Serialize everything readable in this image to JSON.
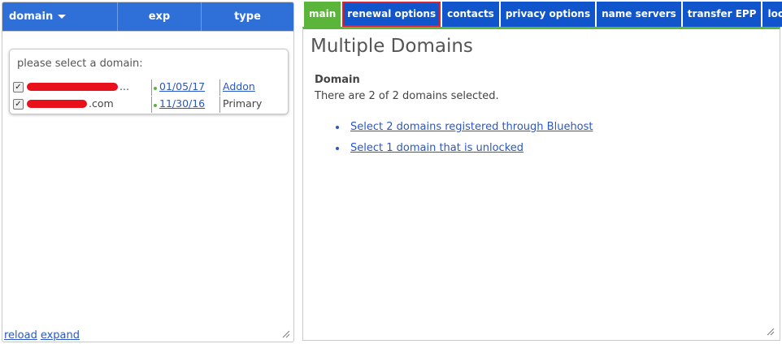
{
  "left_panel": {
    "columns": {
      "domain": "domain",
      "exp": "exp",
      "type": "type"
    },
    "prompt": "please select a domain:",
    "rows": [
      {
        "name_suffix": "...",
        "exp": "01/05/17",
        "type": "Addon",
        "checked": true
      },
      {
        "name_suffix": ".com",
        "exp": "11/30/16",
        "type": "Primary",
        "checked": true
      }
    ],
    "footer": {
      "reload": "reload",
      "expand": "expand"
    }
  },
  "tabs": [
    {
      "label": "main",
      "active": true
    },
    {
      "label": "renewal options",
      "highlighted": true
    },
    {
      "label": "contacts"
    },
    {
      "label": "privacy options"
    },
    {
      "label": "name servers"
    },
    {
      "label": "transfer EPP"
    },
    {
      "label": "lock"
    }
  ],
  "main": {
    "title": "Multiple Domains",
    "section_title": "Domain",
    "selected_info": "There are 2 of 2 domains selected.",
    "links": [
      "Select 2 domains registered through Bluehost",
      "Select 1 domain that is unlocked"
    ]
  },
  "colors": {
    "header_blue": "#2f6fd8",
    "tab_blue": "#1155cc",
    "green": "#5bb53a",
    "link": "#2a57c8",
    "redact_red": "#e8101a"
  }
}
